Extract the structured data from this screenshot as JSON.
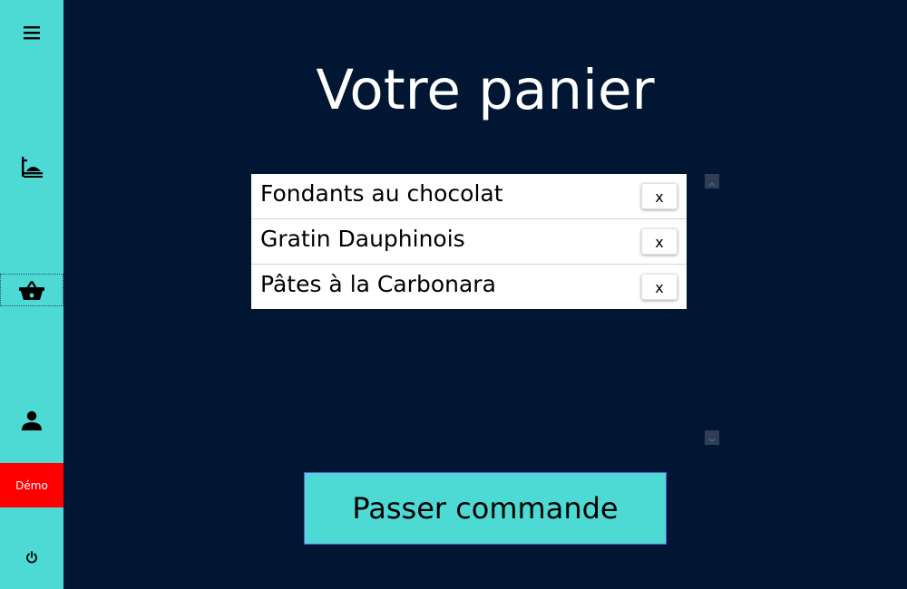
{
  "sidebar": {
    "items": [
      {
        "name": "menu",
        "icon": "hamburger-menu-icon"
      },
      {
        "name": "dishes",
        "icon": "serving-tray-icon"
      },
      {
        "name": "cart",
        "icon": "shopping-basket-icon",
        "active": true
      },
      {
        "name": "account",
        "icon": "user-icon"
      },
      {
        "name": "logout",
        "icon": "power-icon"
      }
    ],
    "demo_label": "Démo",
    "accent": "#4dd9d4",
    "demo_color": "#ff0000"
  },
  "main": {
    "title": "Votre panier",
    "cart_items": [
      {
        "label": "Fondants au chocolat",
        "remove_label": "x"
      },
      {
        "label": "Gratin Dauphinois",
        "remove_label": "x"
      },
      {
        "label": "Pâtes à la Carbonara",
        "remove_label": "x"
      }
    ],
    "order_button_label": "Passer commande",
    "background": "#011633"
  }
}
